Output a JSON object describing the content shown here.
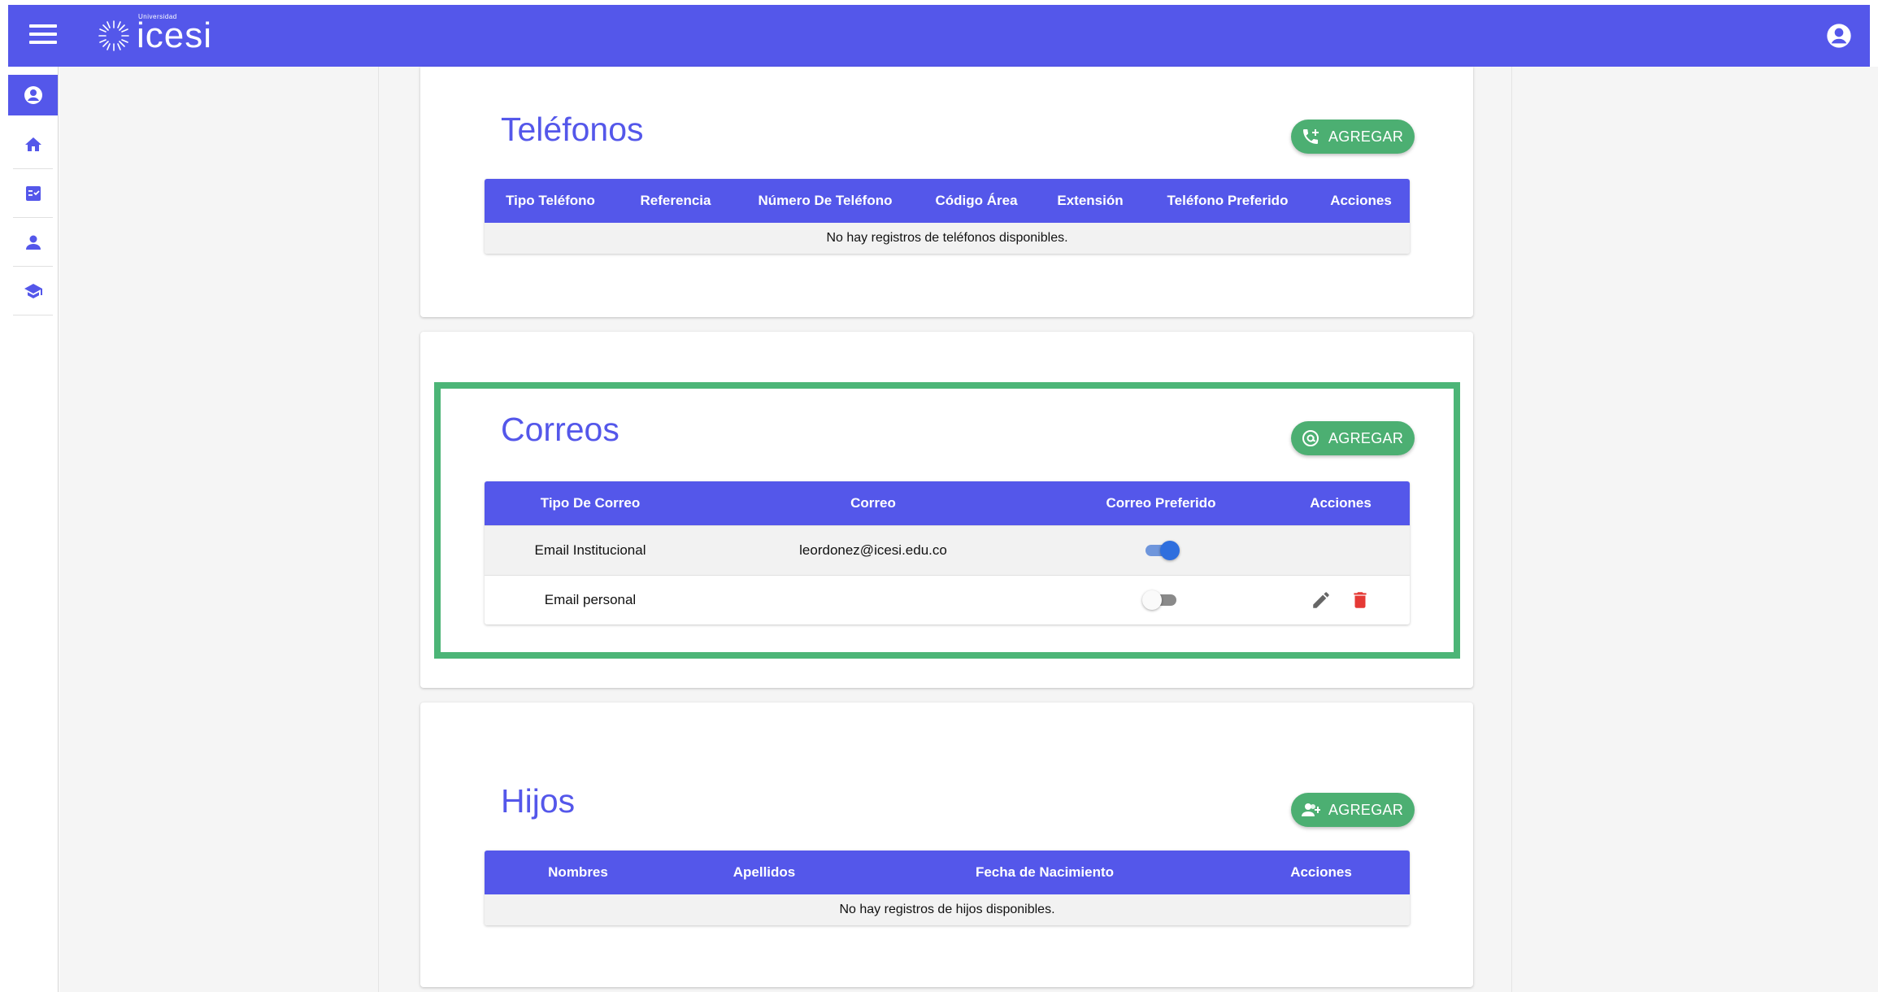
{
  "header": {
    "logo_small": "Universidad",
    "logo_text": "icesi"
  },
  "colors": {
    "primary": "#5457ea",
    "success": "#4caf72",
    "highlight": "#4cb577",
    "danger": "#e53935"
  },
  "icons": {
    "menu": "hamburger-menu-icon",
    "account": "account-circle-icon",
    "sidebar": [
      "account-circle-icon",
      "home-icon",
      "checklist-icon",
      "person-icon",
      "graduation-cap-icon"
    ],
    "phone_add": "phone-plus-icon",
    "email_add": "at-sign-icon",
    "children_add": "person-add-icon",
    "edit": "pencil-icon",
    "delete": "trash-icon"
  },
  "phones": {
    "title": "Teléfonos",
    "add_label": "AGREGAR",
    "columns": [
      "Tipo Teléfono",
      "Referencia",
      "Número De Teléfono",
      "Código Área",
      "Extensión",
      "Teléfono Preferido",
      "Acciones"
    ],
    "empty_message": "No hay registros de teléfonos disponibles."
  },
  "emails": {
    "title": "Correos",
    "add_label": "AGREGAR",
    "columns": [
      "Tipo De Correo",
      "Correo",
      "Correo Preferido",
      "Acciones"
    ],
    "rows": [
      {
        "type": "Email Institucional",
        "email": "leordonez@icesi.edu.co",
        "preferred": true
      },
      {
        "type": "Email personal",
        "email": "",
        "preferred": false
      }
    ]
  },
  "children": {
    "title": "Hijos",
    "add_label": "AGREGAR",
    "columns": [
      "Nombres",
      "Apellidos",
      "Fecha de Nacimiento",
      "Acciones"
    ],
    "empty_message": "No hay registros de hijos disponibles."
  }
}
